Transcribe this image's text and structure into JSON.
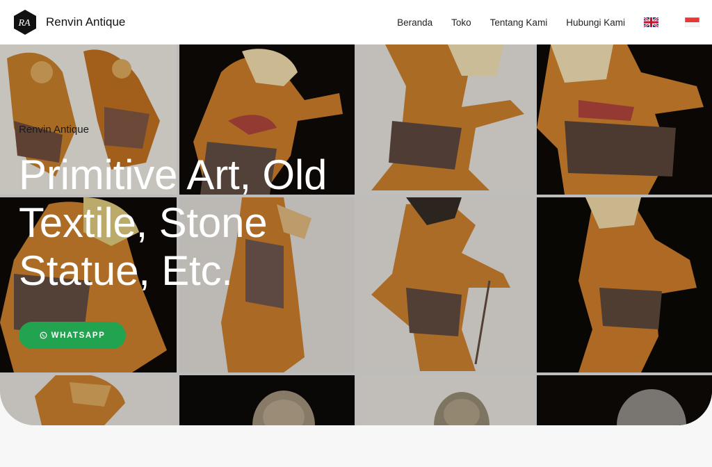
{
  "brand": {
    "logo_text": "RA",
    "name": "Renvin Antique"
  },
  "nav": {
    "items": [
      {
        "label": "Beranda"
      },
      {
        "label": "Toko"
      },
      {
        "label": "Tentang Kami"
      },
      {
        "label": "Hubungi Kami"
      }
    ],
    "flags": [
      "flag-uk-icon",
      "flag-id-icon"
    ]
  },
  "hero": {
    "eyebrow": "Renvin Antique",
    "heading": "Primitive Art, Old Textile, Stone Statue, Etc.",
    "cta_label": "WHATSAPP",
    "cta_icon": "whatsapp-icon",
    "accent_color": "#22a34f"
  }
}
